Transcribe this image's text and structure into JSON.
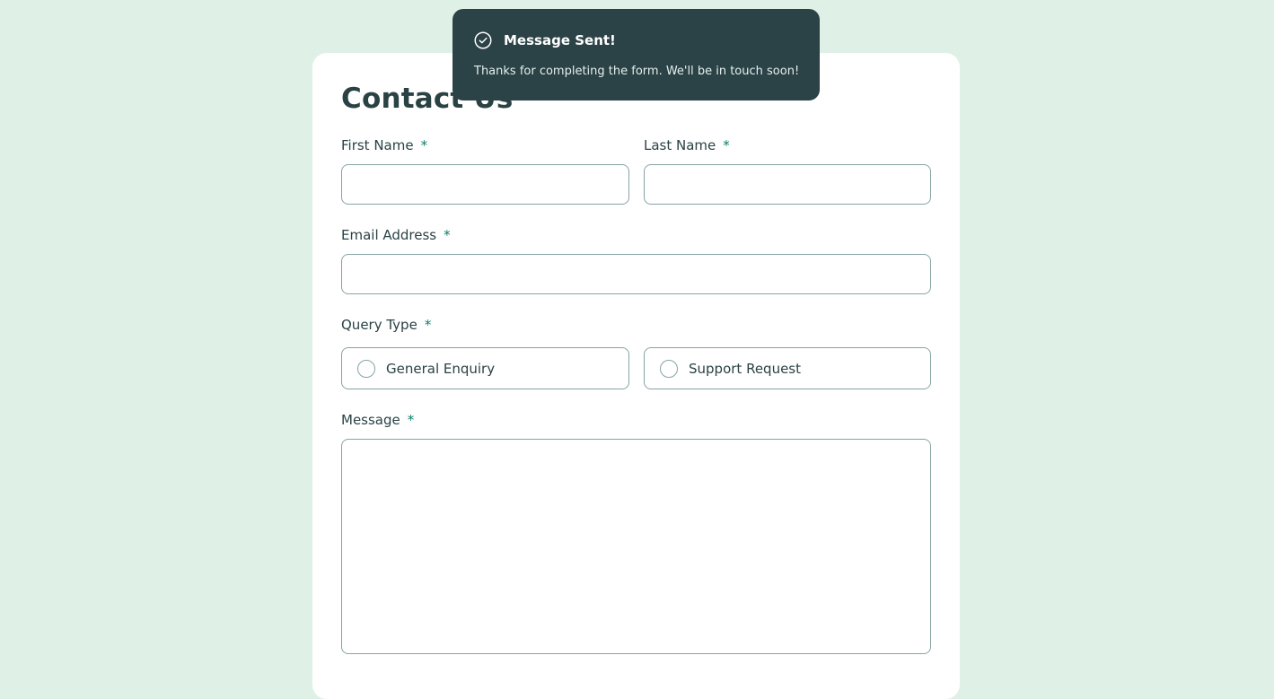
{
  "form": {
    "title": "Contact Us",
    "required_marker": "*",
    "first_name": {
      "label": "First Name",
      "value": "",
      "placeholder": ""
    },
    "last_name": {
      "label": "Last Name",
      "value": "",
      "placeholder": ""
    },
    "email": {
      "label": "Email Address",
      "value": "",
      "placeholder": ""
    },
    "query_type": {
      "label": "Query Type",
      "options": [
        {
          "label": "General Enquiry",
          "selected": false
        },
        {
          "label": "Support Request",
          "selected": false
        }
      ]
    },
    "message": {
      "label": "Message",
      "value": "",
      "placeholder": ""
    }
  },
  "toast": {
    "icon": "check-circle-icon",
    "title": "Message Sent!",
    "body": "Thanks for completing the form. We'll be in touch soon!"
  },
  "colors": {
    "background": "#dff1e7",
    "card": "#ffffff",
    "text": "#2a4244",
    "border": "#87a3a6",
    "accent": "#0c7d69",
    "toast_bg": "#2b4246"
  }
}
